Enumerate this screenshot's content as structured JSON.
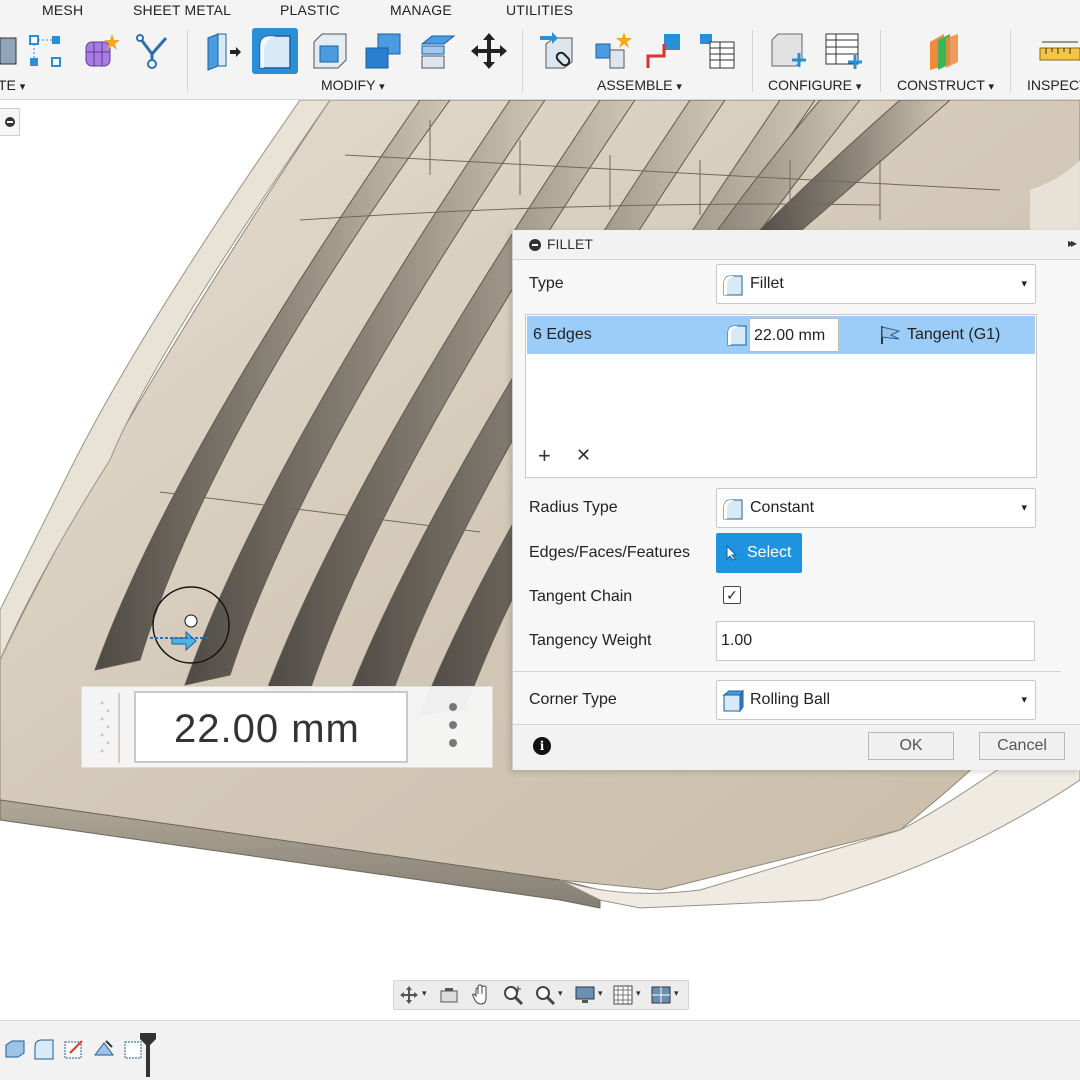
{
  "ribbon": {
    "tabs": [
      "MESH",
      "SHEET METAL",
      "PLASTIC",
      "MANAGE",
      "UTILITIES"
    ],
    "groups": {
      "create": "TE",
      "modify": "MODIFY",
      "assemble": "ASSEMBLE",
      "configure": "CONFIGURE",
      "construct": "CONSTRUCT",
      "inspect": "INSPECT"
    },
    "dropdown_marker": "▾",
    "active_tool": "fillet-tool",
    "accent": "#2a8fd6"
  },
  "fillet_dialog": {
    "title": "FILLET",
    "collapse_icon": "minus-circle-icon",
    "expand_glyph": "▸▸",
    "type_label": "Type",
    "type_value": "Fillet",
    "edge_set": {
      "count": "6 Edges",
      "radius": "22.00 mm",
      "continuity": "Tangent (G1)"
    },
    "add_glyph": "+",
    "remove_glyph": "✕",
    "radius_type_label": "Radius Type",
    "radius_type_value": "Constant",
    "selection_label": "Edges/Faces/Features",
    "select_button": "Select",
    "tangent_chain_label": "Tangent Chain",
    "tangent_chain_checked": true,
    "check_glyph": "✓",
    "tangency_weight_label": "Tangency Weight",
    "tangency_weight": "1.00",
    "corner_type_label": "Corner Type",
    "corner_type_value": "Rolling Ball",
    "info_glyph": "i",
    "ok": "OK",
    "cancel": "Cancel"
  },
  "canvas_input": {
    "value": "22.00 mm"
  },
  "colors": {
    "selection_highlight": "#9ccdf8",
    "select_button": "#1e94e0",
    "model_surface": "#d9cfbf"
  }
}
